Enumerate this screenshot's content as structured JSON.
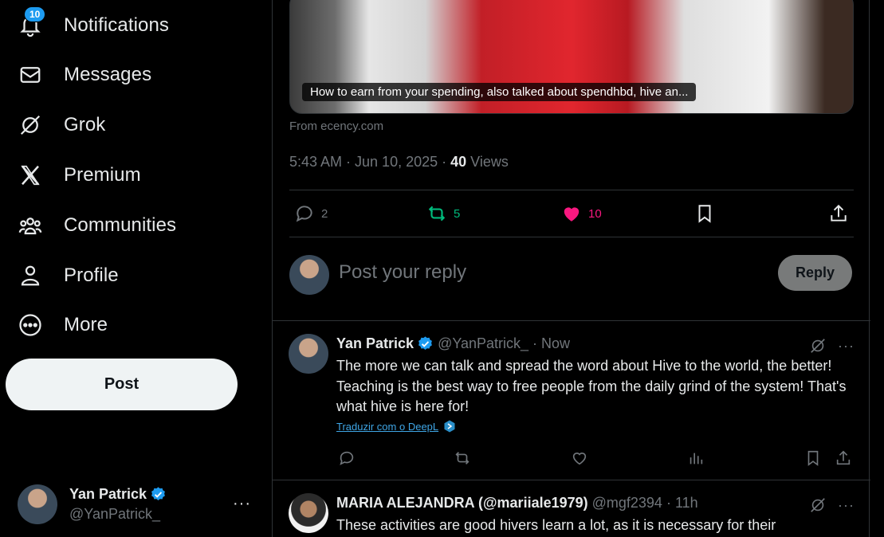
{
  "sidebar": {
    "items": [
      {
        "label": "Notifications",
        "icon": "bell-icon",
        "badge": "10"
      },
      {
        "label": "Messages",
        "icon": "envelope-icon"
      },
      {
        "label": "Grok",
        "icon": "grok-icon"
      },
      {
        "label": "Premium",
        "icon": "x-logo-icon"
      },
      {
        "label": "Communities",
        "icon": "people-icon"
      },
      {
        "label": "Profile",
        "icon": "person-icon"
      },
      {
        "label": "More",
        "icon": "more-circle-icon"
      }
    ],
    "post_label": "Post",
    "account": {
      "name": "Yan Patrick",
      "handle": "@YanPatrick_",
      "more": "···"
    }
  },
  "post": {
    "media_caption": "How to earn from your spending, also talked about spendhbd, hive an...",
    "source": "From ecency.com",
    "time": "5:43 AM · Jun 10, 2025 · ",
    "views_count": "40",
    "views_label": " Views",
    "actions": {
      "replies": "2",
      "reposts": "5",
      "likes": "10"
    }
  },
  "reply_box": {
    "placeholder": "Post your reply",
    "button": "Reply"
  },
  "replies": [
    {
      "name": "Yan Patrick",
      "handle": "@YanPatrick_ · Now",
      "text": "The more we can talk and spread the word about Hive to the world, the better! Teaching is the best way to free people from the daily grind of the system! That's what hive is here for!",
      "translate": "Traduzir com o DeepL",
      "dots": "···"
    },
    {
      "name": "MARIA ALEJANDRA (@mariiale1979)",
      "handle": "@mgf2394 · 11h",
      "text": "These activities are good hivers learn a lot, as it is necessary for their",
      "dots": "···"
    }
  ],
  "colors": {
    "accent": "#1d9bf0",
    "repost": "#00ba7c",
    "like": "#f91880",
    "muted": "#71767b"
  }
}
